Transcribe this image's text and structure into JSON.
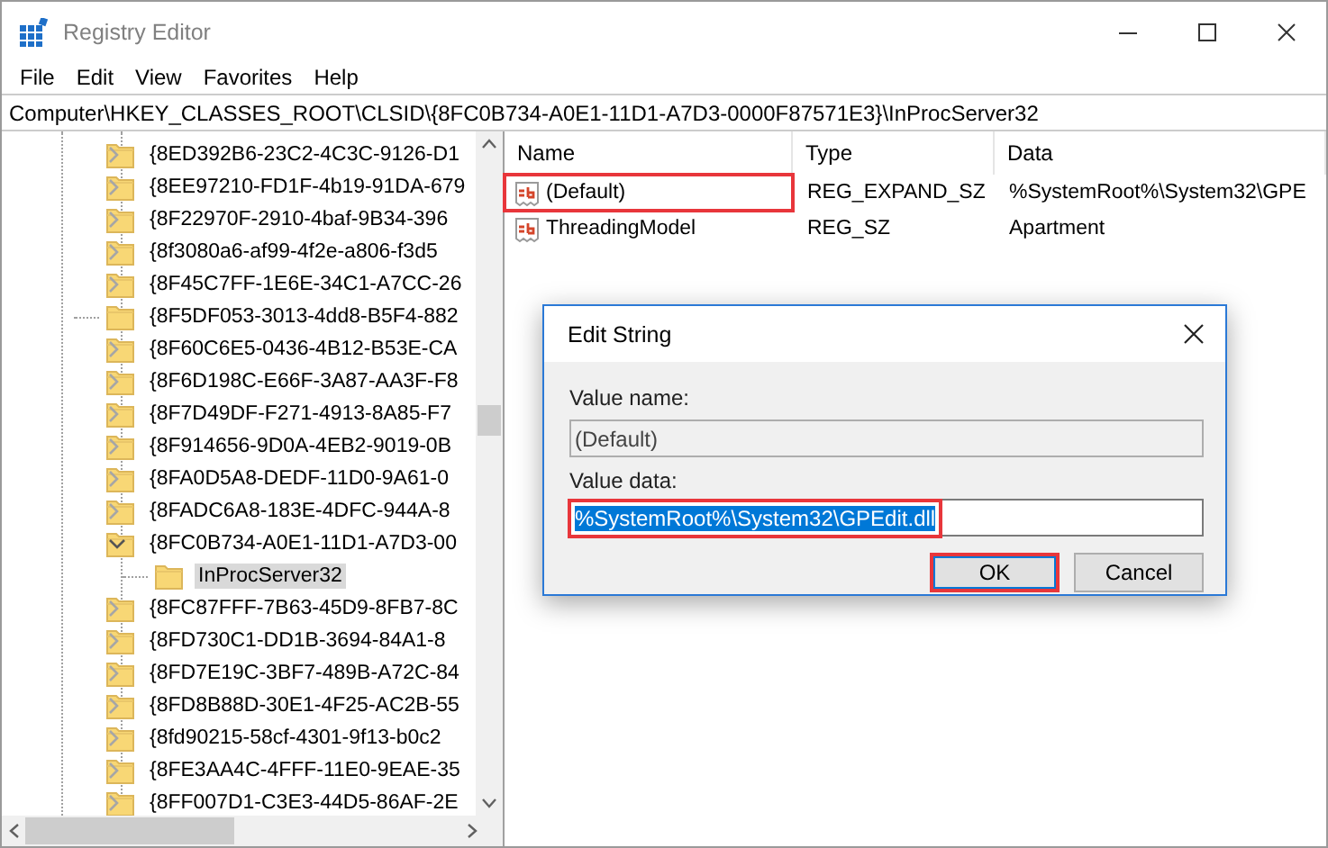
{
  "window": {
    "title": "Registry Editor"
  },
  "menu": [
    "File",
    "Edit",
    "View",
    "Favorites",
    "Help"
  ],
  "address": "Computer\\HKEY_CLASSES_ROOT\\CLSID\\{8FC0B734-A0E1-11D1-A7D3-0000F87571E3}\\InProcServer32",
  "tree": [
    {
      "label": "{8ED392B6-23C2-4C3C-9126-D1",
      "kind": "collapsed",
      "selected": false
    },
    {
      "label": "{8EE97210-FD1F-4b19-91DA-679",
      "kind": "collapsed",
      "selected": false
    },
    {
      "label": "{8F22970F-2910-4baf-9B34-396",
      "kind": "collapsed",
      "selected": false
    },
    {
      "label": "{8f3080a6-af99-4f2e-a806-f3d5",
      "kind": "collapsed",
      "selected": false
    },
    {
      "label": "{8F45C7FF-1E6E-34C1-A7CC-26",
      "kind": "collapsed",
      "selected": false
    },
    {
      "label": "{8F5DF053-3013-4dd8-B5F4-882",
      "kind": "leaf",
      "selected": false
    },
    {
      "label": "{8F60C6E5-0436-4B12-B53E-CA",
      "kind": "collapsed",
      "selected": false
    },
    {
      "label": "{8F6D198C-E66F-3A87-AA3F-F8",
      "kind": "collapsed",
      "selected": false
    },
    {
      "label": "{8F7D49DF-F271-4913-8A85-F7",
      "kind": "collapsed",
      "selected": false
    },
    {
      "label": "{8F914656-9D0A-4EB2-9019-0B",
      "kind": "collapsed",
      "selected": false
    },
    {
      "label": "{8FA0D5A8-DEDF-11D0-9A61-0",
      "kind": "collapsed",
      "selected": false
    },
    {
      "label": "{8FADC6A8-183E-4DFC-944A-8",
      "kind": "collapsed",
      "selected": false
    },
    {
      "label": "{8FC0B734-A0E1-11D1-A7D3-00",
      "kind": "expanded",
      "selected": false,
      "children": [
        {
          "label": "InProcServer32",
          "kind": "leaf",
          "selected": true
        }
      ]
    },
    {
      "label": "{8FC87FFF-7B63-45D9-8FB7-8C",
      "kind": "collapsed",
      "selected": false
    },
    {
      "label": "{8FD730C1-DD1B-3694-84A1-8",
      "kind": "collapsed",
      "selected": false
    },
    {
      "label": "{8FD7E19C-3BF7-489B-A72C-84",
      "kind": "collapsed",
      "selected": false
    },
    {
      "label": "{8FD8B88D-30E1-4F25-AC2B-55",
      "kind": "collapsed",
      "selected": false
    },
    {
      "label": "{8fd90215-58cf-4301-9f13-b0c2",
      "kind": "collapsed",
      "selected": false
    },
    {
      "label": "{8FE3AA4C-4FFF-11E0-9EAE-35",
      "kind": "collapsed",
      "selected": false
    },
    {
      "label": "{8FF007D1-C3E3-44D5-86AF-2E",
      "kind": "collapsed",
      "selected": false
    }
  ],
  "table": {
    "columns": [
      "Name",
      "Type",
      "Data"
    ],
    "rows": [
      {
        "name": "(Default)",
        "type": "REG_EXPAND_SZ",
        "data": "%SystemRoot%\\System32\\GPE",
        "highlighted": true
      },
      {
        "name": "ThreadingModel",
        "type": "REG_SZ",
        "data": "Apartment",
        "highlighted": false
      }
    ]
  },
  "dialog": {
    "title": "Edit String",
    "value_name_label": "Value name:",
    "value_name": "(Default)",
    "value_data_label": "Value data:",
    "value_data": {
      "value": "%SystemRoot%\\System32\\GPEdit.dll",
      "text_selected": true,
      "highlighted": true
    },
    "buttons": [
      {
        "label": "OK",
        "default": true,
        "highlighted": true
      },
      {
        "label": "Cancel",
        "default": false,
        "highlighted": false
      }
    ]
  }
}
